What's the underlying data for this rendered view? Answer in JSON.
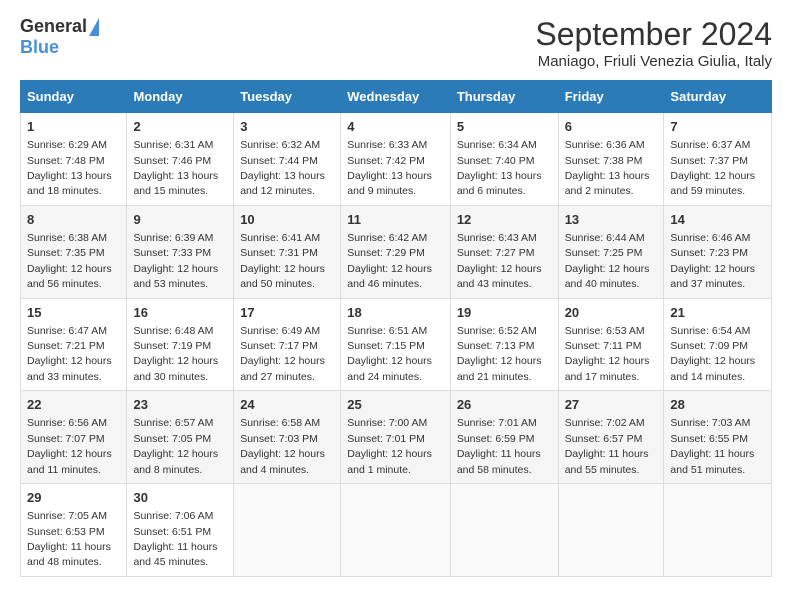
{
  "header": {
    "logo_general": "General",
    "logo_blue": "Blue",
    "title": "September 2024",
    "subtitle": "Maniago, Friuli Venezia Giulia, Italy"
  },
  "days_of_week": [
    "Sunday",
    "Monday",
    "Tuesday",
    "Wednesday",
    "Thursday",
    "Friday",
    "Saturday"
  ],
  "weeks": [
    [
      {
        "day": "1",
        "sunrise": "Sunrise: 6:29 AM",
        "sunset": "Sunset: 7:48 PM",
        "daylight": "Daylight: 13 hours and 18 minutes."
      },
      {
        "day": "2",
        "sunrise": "Sunrise: 6:31 AM",
        "sunset": "Sunset: 7:46 PM",
        "daylight": "Daylight: 13 hours and 15 minutes."
      },
      {
        "day": "3",
        "sunrise": "Sunrise: 6:32 AM",
        "sunset": "Sunset: 7:44 PM",
        "daylight": "Daylight: 13 hours and 12 minutes."
      },
      {
        "day": "4",
        "sunrise": "Sunrise: 6:33 AM",
        "sunset": "Sunset: 7:42 PM",
        "daylight": "Daylight: 13 hours and 9 minutes."
      },
      {
        "day": "5",
        "sunrise": "Sunrise: 6:34 AM",
        "sunset": "Sunset: 7:40 PM",
        "daylight": "Daylight: 13 hours and 6 minutes."
      },
      {
        "day": "6",
        "sunrise": "Sunrise: 6:36 AM",
        "sunset": "Sunset: 7:38 PM",
        "daylight": "Daylight: 13 hours and 2 minutes."
      },
      {
        "day": "7",
        "sunrise": "Sunrise: 6:37 AM",
        "sunset": "Sunset: 7:37 PM",
        "daylight": "Daylight: 12 hours and 59 minutes."
      }
    ],
    [
      {
        "day": "8",
        "sunrise": "Sunrise: 6:38 AM",
        "sunset": "Sunset: 7:35 PM",
        "daylight": "Daylight: 12 hours and 56 minutes."
      },
      {
        "day": "9",
        "sunrise": "Sunrise: 6:39 AM",
        "sunset": "Sunset: 7:33 PM",
        "daylight": "Daylight: 12 hours and 53 minutes."
      },
      {
        "day": "10",
        "sunrise": "Sunrise: 6:41 AM",
        "sunset": "Sunset: 7:31 PM",
        "daylight": "Daylight: 12 hours and 50 minutes."
      },
      {
        "day": "11",
        "sunrise": "Sunrise: 6:42 AM",
        "sunset": "Sunset: 7:29 PM",
        "daylight": "Daylight: 12 hours and 46 minutes."
      },
      {
        "day": "12",
        "sunrise": "Sunrise: 6:43 AM",
        "sunset": "Sunset: 7:27 PM",
        "daylight": "Daylight: 12 hours and 43 minutes."
      },
      {
        "day": "13",
        "sunrise": "Sunrise: 6:44 AM",
        "sunset": "Sunset: 7:25 PM",
        "daylight": "Daylight: 12 hours and 40 minutes."
      },
      {
        "day": "14",
        "sunrise": "Sunrise: 6:46 AM",
        "sunset": "Sunset: 7:23 PM",
        "daylight": "Daylight: 12 hours and 37 minutes."
      }
    ],
    [
      {
        "day": "15",
        "sunrise": "Sunrise: 6:47 AM",
        "sunset": "Sunset: 7:21 PM",
        "daylight": "Daylight: 12 hours and 33 minutes."
      },
      {
        "day": "16",
        "sunrise": "Sunrise: 6:48 AM",
        "sunset": "Sunset: 7:19 PM",
        "daylight": "Daylight: 12 hours and 30 minutes."
      },
      {
        "day": "17",
        "sunrise": "Sunrise: 6:49 AM",
        "sunset": "Sunset: 7:17 PM",
        "daylight": "Daylight: 12 hours and 27 minutes."
      },
      {
        "day": "18",
        "sunrise": "Sunrise: 6:51 AM",
        "sunset": "Sunset: 7:15 PM",
        "daylight": "Daylight: 12 hours and 24 minutes."
      },
      {
        "day": "19",
        "sunrise": "Sunrise: 6:52 AM",
        "sunset": "Sunset: 7:13 PM",
        "daylight": "Daylight: 12 hours and 21 minutes."
      },
      {
        "day": "20",
        "sunrise": "Sunrise: 6:53 AM",
        "sunset": "Sunset: 7:11 PM",
        "daylight": "Daylight: 12 hours and 17 minutes."
      },
      {
        "day": "21",
        "sunrise": "Sunrise: 6:54 AM",
        "sunset": "Sunset: 7:09 PM",
        "daylight": "Daylight: 12 hours and 14 minutes."
      }
    ],
    [
      {
        "day": "22",
        "sunrise": "Sunrise: 6:56 AM",
        "sunset": "Sunset: 7:07 PM",
        "daylight": "Daylight: 12 hours and 11 minutes."
      },
      {
        "day": "23",
        "sunrise": "Sunrise: 6:57 AM",
        "sunset": "Sunset: 7:05 PM",
        "daylight": "Daylight: 12 hours and 8 minutes."
      },
      {
        "day": "24",
        "sunrise": "Sunrise: 6:58 AM",
        "sunset": "Sunset: 7:03 PM",
        "daylight": "Daylight: 12 hours and 4 minutes."
      },
      {
        "day": "25",
        "sunrise": "Sunrise: 7:00 AM",
        "sunset": "Sunset: 7:01 PM",
        "daylight": "Daylight: 12 hours and 1 minute."
      },
      {
        "day": "26",
        "sunrise": "Sunrise: 7:01 AM",
        "sunset": "Sunset: 6:59 PM",
        "daylight": "Daylight: 11 hours and 58 minutes."
      },
      {
        "day": "27",
        "sunrise": "Sunrise: 7:02 AM",
        "sunset": "Sunset: 6:57 PM",
        "daylight": "Daylight: 11 hours and 55 minutes."
      },
      {
        "day": "28",
        "sunrise": "Sunrise: 7:03 AM",
        "sunset": "Sunset: 6:55 PM",
        "daylight": "Daylight: 11 hours and 51 minutes."
      }
    ],
    [
      {
        "day": "29",
        "sunrise": "Sunrise: 7:05 AM",
        "sunset": "Sunset: 6:53 PM",
        "daylight": "Daylight: 11 hours and 48 minutes."
      },
      {
        "day": "30",
        "sunrise": "Sunrise: 7:06 AM",
        "sunset": "Sunset: 6:51 PM",
        "daylight": "Daylight: 11 hours and 45 minutes."
      },
      null,
      null,
      null,
      null,
      null
    ]
  ]
}
